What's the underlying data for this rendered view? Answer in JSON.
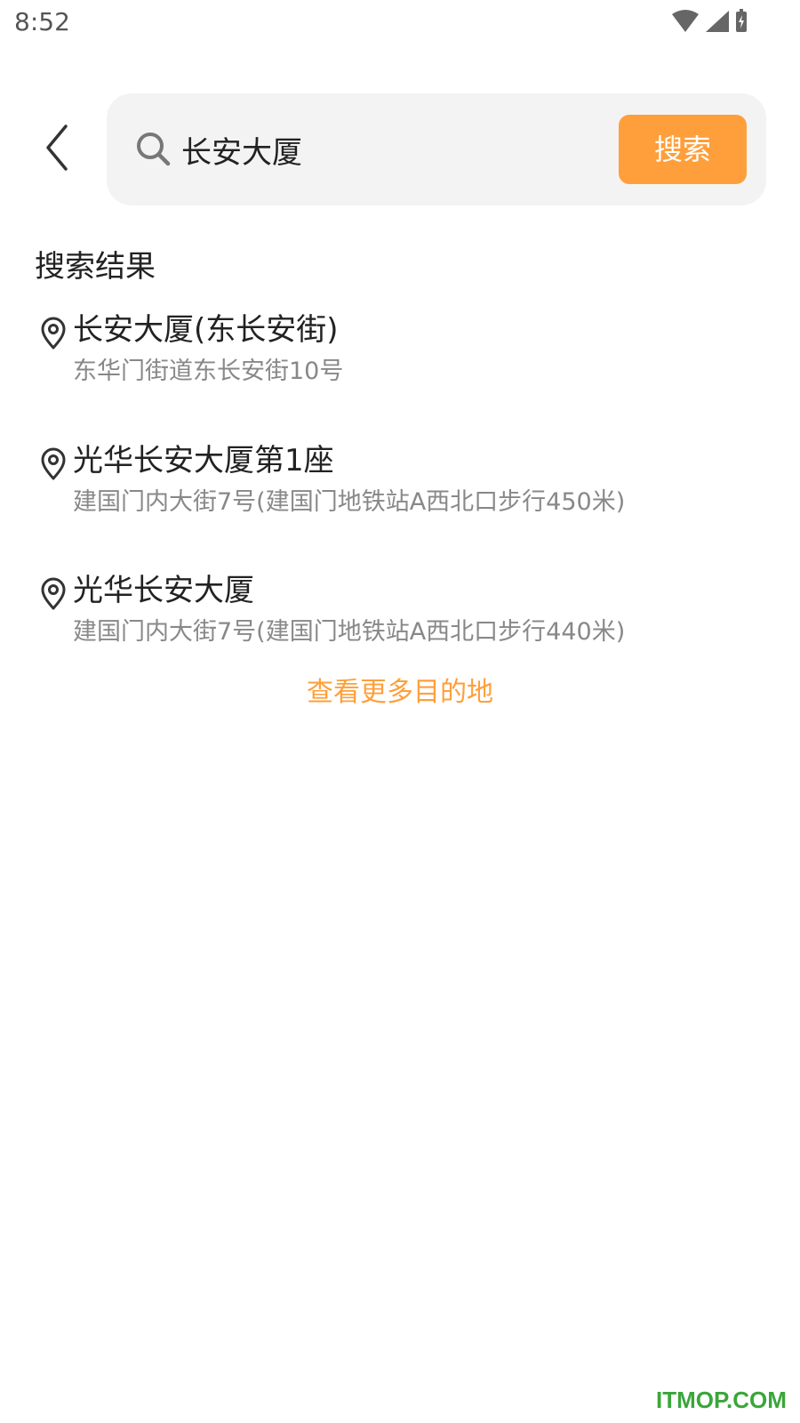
{
  "status_bar": {
    "time": "8:52",
    "icons": [
      "wifi-icon",
      "cell-signal-icon",
      "battery-charging-icon"
    ]
  },
  "header": {
    "back_icon": "chevron-left-icon",
    "search_icon": "search-icon",
    "search_value": "长安大厦",
    "search_button_label": "搜索"
  },
  "results": {
    "heading": "搜索结果",
    "items": [
      {
        "title": "长安大厦(东长安街)",
        "address": "东华门街道东长安街10号"
      },
      {
        "title": "光华长安大厦第1座",
        "address": "建国门内大街7号(建国门地铁站A西北口步行450米)"
      },
      {
        "title": "光华长安大厦",
        "address": "建国门内大街7号(建国门地铁站A西北口步行440米)"
      }
    ],
    "more_label": "查看更多目的地"
  },
  "colors": {
    "accent": "#ff9f3b",
    "search_bg": "#f3f3f3",
    "text_primary": "#222222",
    "text_secondary": "#888888",
    "watermark": "#3aa63a"
  },
  "watermark": "ITMOP.COM"
}
